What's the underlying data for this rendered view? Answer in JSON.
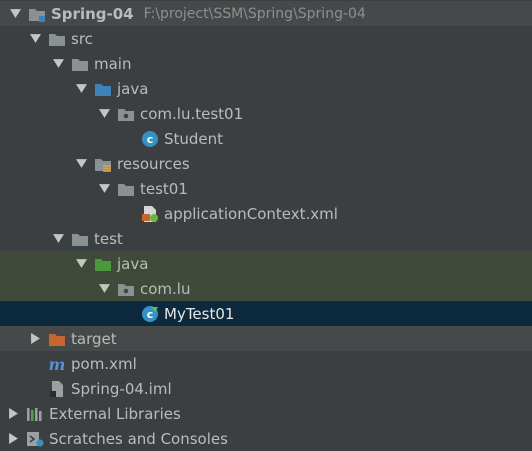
{
  "tree": {
    "root": {
      "label": "Spring-04",
      "path": "F:\\project\\SSM\\Spring\\Spring-04"
    },
    "src": "src",
    "main": "main",
    "main_java": "java",
    "pkg_main": "com.lu.test01",
    "student": "Student",
    "resources": "resources",
    "res_test01": "test01",
    "app_ctx": "applicationContext.xml",
    "test": "test",
    "test_java": "java",
    "pkg_test": "com.lu",
    "mytest": "MyTest01",
    "target": "target",
    "pom": "pom.xml",
    "iml": "Spring-04.iml",
    "ext_libs": "External Libraries",
    "scratches": "Scratches and Consoles"
  },
  "colors": {
    "background": "#3c3f41",
    "selection": "#0d293e",
    "test_highlight": "#3f4a3b",
    "folder": "#8a9195",
    "source_folder": "#3d83b6",
    "test_folder": "#4a9a3d",
    "excluded_folder": "#c7652c"
  },
  "icons": {
    "module": "module-folder-icon",
    "folder": "folder-icon",
    "source_root": "source-root-icon",
    "package": "package-icon",
    "class": "java-class-icon",
    "resources": "resources-folder-icon",
    "spring_xml": "spring-xml-icon",
    "test_root": "test-root-icon",
    "test_class": "test-class-icon",
    "excluded": "excluded-folder-icon",
    "maven": "maven-icon",
    "iml": "iml-file-icon",
    "libraries": "libraries-icon",
    "scratches": "scratches-icon"
  }
}
